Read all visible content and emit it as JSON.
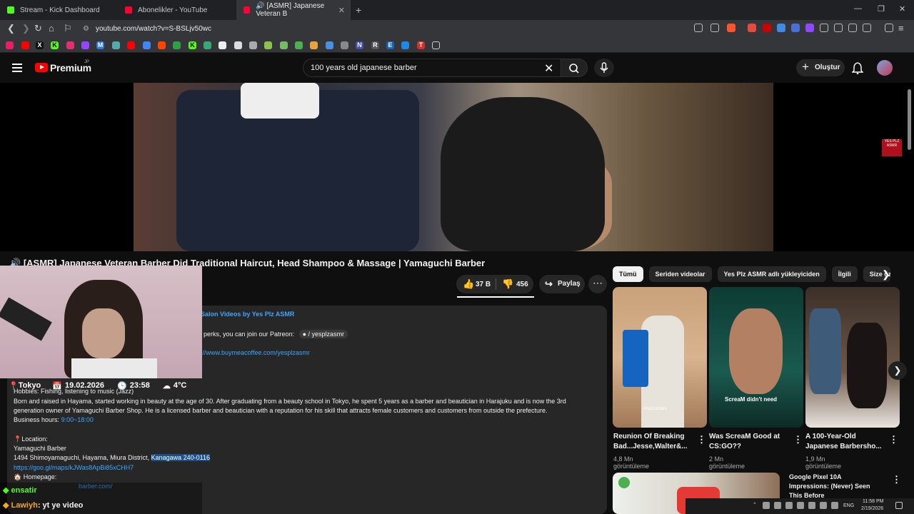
{
  "browser": {
    "tabs": [
      {
        "title": "Stream - Kick Dashboard",
        "fav_color": "#53fc18"
      },
      {
        "title": "Abonelikler - YouTube",
        "fav_color": "#ff0033"
      },
      {
        "title": "🔊 [ASMR] Japanese Veteran B",
        "fav_color": "#ff0033"
      }
    ],
    "url": "youtube.com/watch?v=S-BSLjv50wc"
  },
  "youtube": {
    "logo_text": "Premium",
    "logo_region": "JP",
    "search_value": "100 years old japanese barber",
    "create_label": "Oluştur"
  },
  "video": {
    "title": "[ASMR] Japanese Veteran Barber Did Traditional Haircut, Head Shampoo & Massage | Yamaguchi Barber",
    "likes": "37 B",
    "dislikes": "456",
    "share_label": "Paylaş",
    "watermark": "YES PLZ ASMR"
  },
  "stream_overlay": {
    "city": "Tokyo",
    "date": "19.02.2026",
    "time": "23:58",
    "temp": "4°C"
  },
  "description": {
    "playlist": "Salon Videos by Yes Plz ASMR",
    "patreon": "perks, you can join our Patreon:",
    "patreon_link": "/ yesplzasmr",
    "coffee": "www.buymeacoffee.com/yesplzasmr",
    "hobbies": "Hobbies: Fishing, listening to music (Jazz)",
    "bio": "Born and raised in Hayama, started working in beauty at the age of 30. After graduating from a beauty school in Tokyo, he spent 5 years as a barber and beautician in Harajuku and is now the 3rd generation owner of Yamaguchi Barber Shop. He is a licensed barber and beautician with a reputation for his skill that attracts female customers and customers from outside the prefecture.",
    "hours_label": "Business hours:",
    "hours": "9:00~18:00",
    "location_label": "Location:",
    "shop": "Yamaguchi Barber",
    "address": "1494 Shimoyamaguchi, Hayama, Miura District,",
    "address_highlight": "Kanagawa 240-0116",
    "map_link": "https://goo.gl/maps/kJWas8ApBi85xCHH7",
    "homepage_label": "Homepage:",
    "homepage_link": "barber.com/"
  },
  "chips": [
    "Tümü",
    "Seriden videolar",
    "Yes Plz ASMR adlı yükleyiciden",
    "İlgili",
    "Size öz"
  ],
  "shorts": [
    {
      "title": "Reunion Of Breaking Bad...Jesse,Walter&...",
      "views": "4,8 Mn görüntüleme",
      "caption": "PopCorners"
    },
    {
      "title": "Was ScreaM Good at CS:GO??",
      "views": "2 Mn görüntüleme",
      "caption": "ScreaM didn't need"
    },
    {
      "title": "A 100-Year-Old Japanese Barbersho...",
      "views": "1,9 Mn görüntüleme",
      "caption": ""
    }
  ],
  "recommendation": {
    "title": "Google Pixel 10A Impressions: (Never) Seen This Before"
  },
  "chat": [
    {
      "user": "ensatir",
      "message": ""
    },
    {
      "user": "Lawiyh",
      "message": ": yt ye video"
    }
  ],
  "taskbar": {
    "lang": "ENG",
    "time": "11:58 PM",
    "date": "2/19/2026"
  }
}
